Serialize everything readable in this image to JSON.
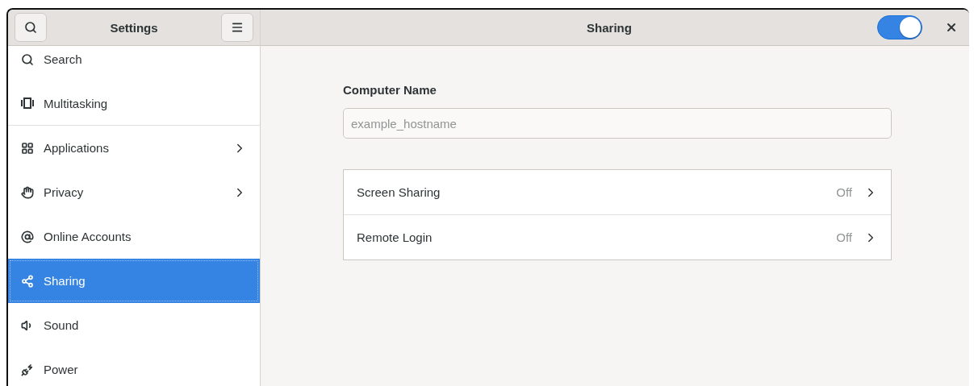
{
  "sidebar": {
    "title": "Settings",
    "items": [
      {
        "label": "Search",
        "kind": "search",
        "selected": false,
        "submenu": false,
        "divider_after": false
      },
      {
        "label": "Multitasking",
        "kind": "multitasking",
        "selected": false,
        "submenu": false,
        "divider_after": true
      },
      {
        "label": "Applications",
        "kind": "applications",
        "selected": false,
        "submenu": true,
        "divider_after": false
      },
      {
        "label": "Privacy",
        "kind": "privacy",
        "selected": false,
        "submenu": true,
        "divider_after": false
      },
      {
        "label": "Online Accounts",
        "kind": "accounts",
        "selected": false,
        "submenu": false,
        "divider_after": false
      },
      {
        "label": "Sharing",
        "kind": "sharing",
        "selected": true,
        "submenu": false,
        "divider_after": false
      },
      {
        "label": "Sound",
        "kind": "sound",
        "selected": false,
        "submenu": false,
        "divider_after": false
      },
      {
        "label": "Power",
        "kind": "power",
        "selected": false,
        "submenu": false,
        "divider_after": false
      }
    ]
  },
  "header": {
    "title": "Sharing",
    "switch": {
      "on": true
    }
  },
  "computer_name": {
    "label": "Computer Name",
    "placeholder": "example_hostname"
  },
  "services": [
    {
      "label": "Screen Sharing",
      "status": "Off"
    },
    {
      "label": "Remote Login",
      "status": "Off"
    }
  ]
}
